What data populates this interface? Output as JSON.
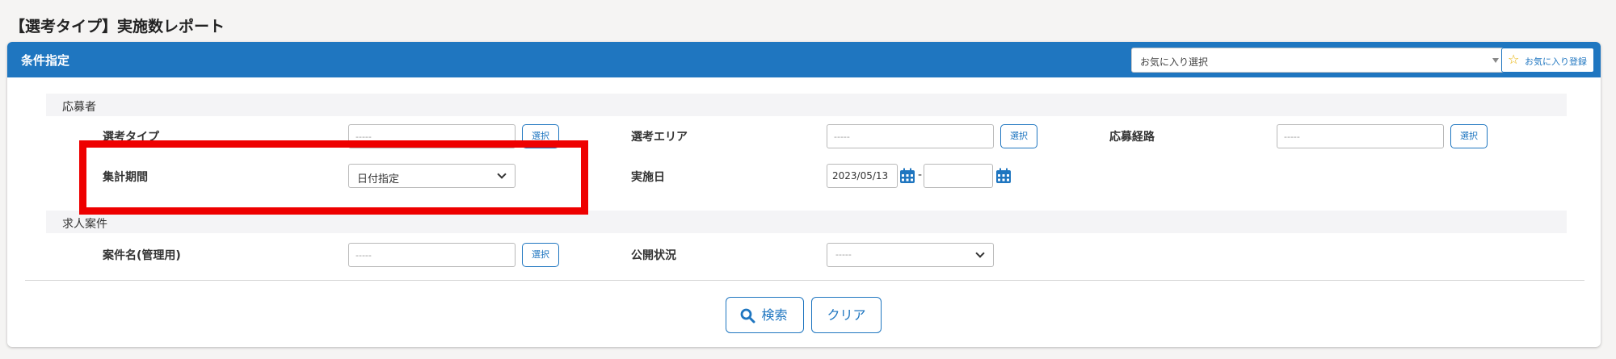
{
  "page": {
    "title": "【選考タイプ】実施数レポート"
  },
  "panel": {
    "title": "条件指定",
    "favorite_select": {
      "value": "お気に入り選択"
    },
    "favorite_button": {
      "label": "お気に入り登録",
      "icon": "star-icon"
    }
  },
  "sections": {
    "applicant": "応募者",
    "job": "求人案件"
  },
  "fields": {
    "selection_type": {
      "label": "選考タイプ",
      "value": "-----",
      "button": "選択"
    },
    "selection_area": {
      "label": "選考エリア",
      "value": "-----",
      "button": "選択"
    },
    "application_route": {
      "label": "応募経路",
      "value": "-----",
      "button": "選択"
    },
    "aggregation_period": {
      "label": "集計期間",
      "value": "日付指定"
    },
    "implementation_date": {
      "label": "実施日",
      "from": "2023/05/13",
      "separator": "-",
      "to": ""
    },
    "case_name": {
      "label": "案件名(管理用)",
      "value": "-----",
      "button": "選択"
    },
    "publish_status": {
      "label": "公開状況",
      "value": "-----"
    }
  },
  "actions": {
    "search": {
      "label": "検索",
      "icon": "search-icon"
    },
    "clear": {
      "label": "クリア"
    }
  },
  "colors": {
    "header": "#1f76c0",
    "accent": "#1f76c0",
    "highlight": "#ee0000",
    "star": "#e8b100"
  }
}
